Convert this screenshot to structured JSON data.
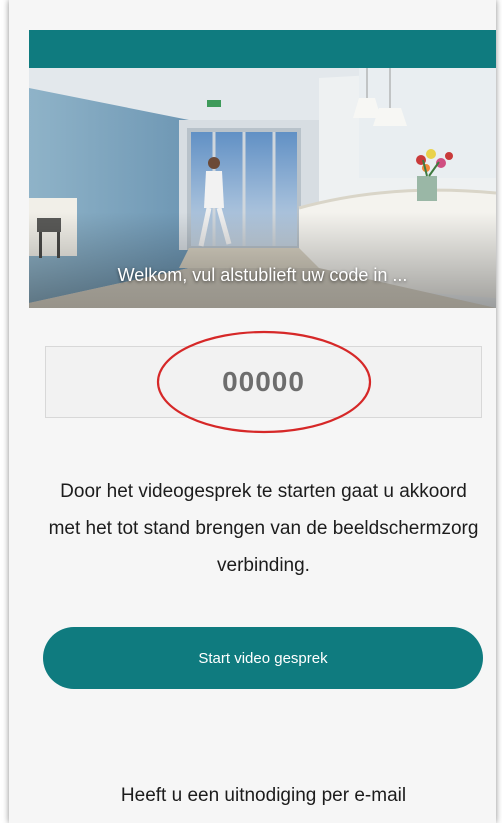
{
  "hero": {
    "welcome_text": "Welkom, vul alstublieft uw code in ..."
  },
  "code_input": {
    "placeholder": "00000",
    "value": ""
  },
  "consent": {
    "text": "Door het videogesprek te starten gaat u akkoord met het tot stand brengen van de beeldschermzorg verbinding."
  },
  "start_button": {
    "label": "Start video gesprek"
  },
  "invite": {
    "text": "Heeft u een uitnodiging per e-mail"
  },
  "colors": {
    "accent": "#0f7b7f",
    "annotation": "#d62828"
  }
}
